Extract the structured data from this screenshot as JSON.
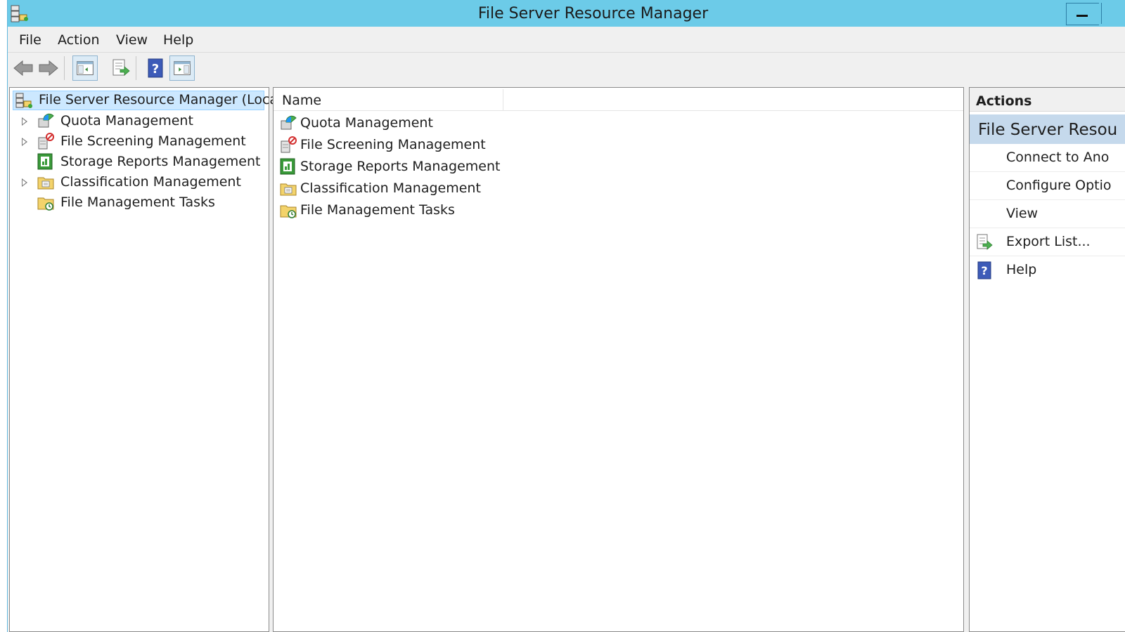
{
  "window": {
    "title": "File Server Resource Manager"
  },
  "menu": [
    "File",
    "Action",
    "View",
    "Help"
  ],
  "toolbar": {
    "buttons": [
      "back-icon",
      "forward-icon",
      "show-hide-console-tree-icon",
      "export-list-icon",
      "help-icon",
      "show-hide-action-pane-icon"
    ]
  },
  "tree": {
    "root": "File Server Resource Manager (Local)",
    "items": [
      {
        "label": "Quota Management",
        "icon": "quota-icon",
        "expandable": true
      },
      {
        "label": "File Screening Management",
        "icon": "file-screening-icon",
        "expandable": true
      },
      {
        "label": "Storage Reports Management",
        "icon": "storage-reports-icon",
        "expandable": false
      },
      {
        "label": "Classification Management",
        "icon": "classification-icon",
        "expandable": true
      },
      {
        "label": "File Management Tasks",
        "icon": "file-management-tasks-icon",
        "expandable": false
      }
    ]
  },
  "list": {
    "column": "Name",
    "rows": [
      "Quota Management",
      "File Screening Management",
      "Storage Reports Management",
      "Classification Management",
      "File Management Tasks"
    ]
  },
  "actions": {
    "header": "Actions",
    "section": "File Server Resou",
    "items": [
      {
        "label": "Connect to Ano",
        "icon": ""
      },
      {
        "label": "Configure Optio",
        "icon": ""
      },
      {
        "label": "View",
        "icon": ""
      },
      {
        "label": "Export List...",
        "icon": "export-list-icon"
      },
      {
        "label": "Help",
        "icon": "help-icon"
      }
    ]
  },
  "colors": {
    "titlebar": "#6ccbe8",
    "selection": "#cce8ff",
    "actions_section": "#c5d9ec"
  }
}
